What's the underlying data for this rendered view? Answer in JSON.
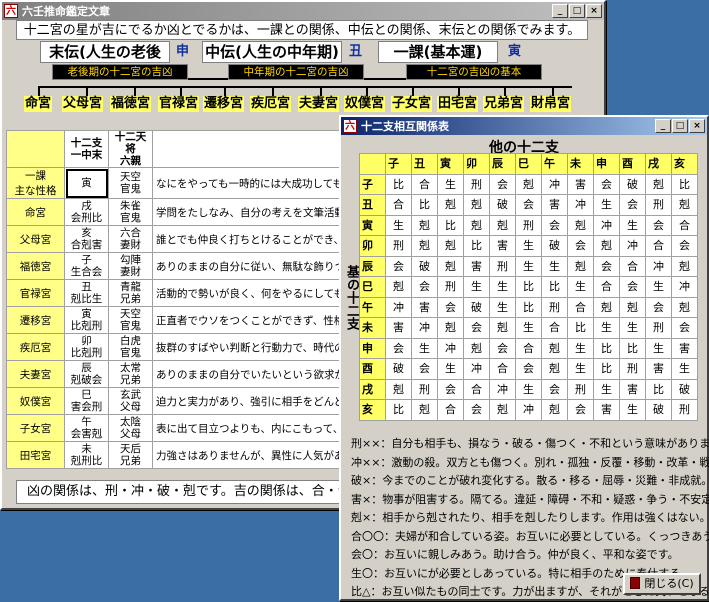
{
  "main": {
    "title": "六壬推命鑑定文章",
    "intro": "十二宮の星が吉にでるか凶とでるかは、一課との関係、中伝との関係、末伝との関係でみます。",
    "periods": [
      {
        "label": "末伝(人生の老後期)",
        "branch": "申"
      },
      {
        "label": "中伝(人生の中年期)",
        "branch": "丑"
      },
      {
        "label": "一課(基本運)",
        "branch": "寅"
      }
    ],
    "keys": [
      "老後期の十二宮の吉凶",
      "中年期の十二宮の吉凶",
      "十二宮の吉凶の基本"
    ],
    "palaces": [
      "命宮",
      "父母宮",
      "福徳宮",
      "官禄宮",
      "遷移宮",
      "疾厄宮",
      "夫妻宮",
      "奴僕宮",
      "子女宮",
      "田宅宮",
      "兄弟宮",
      "財帛宮"
    ],
    "table": {
      "headers": [
        "十二支\n一中末",
        "十二天将\n六親",
        ""
      ],
      "rows": [
        {
          "label": "一課\n主な性格",
          "c1": "寅",
          "c2": "天空\n官鬼",
          "text": "なにをやっても一時的には大成功しても、"
        },
        {
          "label": "命宮",
          "c1": "戌\n会刑比",
          "c2": "朱雀\n官鬼",
          "text": "学問をたしなみ、自分の考えを文筆活動"
        },
        {
          "label": "父母宮",
          "c1": "亥\n合剋害",
          "c2": "六合\n妻財",
          "text": "誰とでも仲良く打ちとけることができ、人"
        },
        {
          "label": "福徳宮",
          "c1": "子\n生合会",
          "c2": "勾陣\n妻財",
          "text": "ありのままの自分に従い、無駄な飾りつけ"
        },
        {
          "label": "官禄宮",
          "c1": "丑\n剋比生",
          "c2": "青龍\n兄弟",
          "text": "活動的で勢いが良く、何をやるにしても大"
        },
        {
          "label": "遷移宮",
          "c1": "寅\n比剋刑",
          "c2": "天空\n官鬼",
          "text": "正直者でウソをつくことができず、性格的"
        },
        {
          "label": "疾厄宮",
          "c1": "卯\n比剋刑",
          "c2": "白虎\n官鬼",
          "text": "抜群のすばやい判断と行動力で、時代の波"
        },
        {
          "label": "夫妻宮",
          "c1": "辰\n剋破会",
          "c2": "太常\n兄弟",
          "text": "ありのままの自分でいたいという欲求が強"
        },
        {
          "label": "奴僕宮",
          "c1": "巳\n害会刑",
          "c2": "玄武\n父母",
          "text": "迫力と実力があり、強引に相手をどんどん"
        },
        {
          "label": "子女宮",
          "c1": "午\n会害剋",
          "c2": "太陰\n父母",
          "text": "表に出て目立つよりも、内にこもって、ま"
        },
        {
          "label": "田宅宮",
          "c1": "未\n剋刑比",
          "c2": "天后\n兄弟",
          "text": "力強さはありませんが、異性に人気があり"
        }
      ]
    },
    "footer": "凶の関係は、刑・冲・破・剋です。吉の関係は、合・会・生・同"
  },
  "relation": {
    "title": "十二支相互関係表",
    "top_label": "他の十二支",
    "side_label": "基の十二支",
    "branches": [
      "子",
      "丑",
      "寅",
      "卯",
      "辰",
      "巳",
      "午",
      "未",
      "申",
      "酉",
      "戌",
      "亥"
    ],
    "matrix": [
      [
        "比",
        "合",
        "生",
        "刑",
        "会",
        "剋",
        "冲",
        "害",
        "会",
        "破",
        "剋",
        "比"
      ],
      [
        "合",
        "比",
        "剋",
        "剋",
        "破",
        "会",
        "害",
        "冲",
        "生",
        "会",
        "刑",
        "剋"
      ],
      [
        "生",
        "剋",
        "比",
        "剋",
        "剋",
        "刑",
        "会",
        "剋",
        "冲",
        "生",
        "会",
        "合"
      ],
      [
        "刑",
        "剋",
        "剋",
        "比",
        "害",
        "生",
        "破",
        "会",
        "剋",
        "冲",
        "合",
        "会"
      ],
      [
        "会",
        "破",
        "剋",
        "害",
        "刑",
        "生",
        "生",
        "剋",
        "会",
        "合",
        "冲",
        "剋"
      ],
      [
        "剋",
        "会",
        "刑",
        "生",
        "生",
        "比",
        "比",
        "生",
        "合",
        "会",
        "生",
        "冲"
      ],
      [
        "冲",
        "害",
        "会",
        "破",
        "生",
        "比",
        "刑",
        "合",
        "剋",
        "剋",
        "会",
        "剋"
      ],
      [
        "害",
        "冲",
        "剋",
        "会",
        "剋",
        "生",
        "合",
        "比",
        "生",
        "生",
        "刑",
        "会"
      ],
      [
        "会",
        "生",
        "冲",
        "剋",
        "会",
        "合",
        "剋",
        "生",
        "比",
        "比",
        "生",
        "害"
      ],
      [
        "破",
        "会",
        "生",
        "冲",
        "合",
        "会",
        "剋",
        "生",
        "比",
        "刑",
        "害",
        "生"
      ],
      [
        "剋",
        "刑",
        "会",
        "合",
        "冲",
        "生",
        "会",
        "刑",
        "生",
        "害",
        "比",
        "破"
      ],
      [
        "比",
        "剋",
        "合",
        "会",
        "剋",
        "冲",
        "剋",
        "会",
        "害",
        "生",
        "破",
        "刑"
      ]
    ],
    "legend": [
      "刑××：自分も相手も、損なう・破る・傷つく・不和という意味があります。",
      "冲××：激動の殺。双方とも傷つく。別れ・孤独・反覆・移動・改革・戦い。",
      "破×：今までのことが破れ変化する。散る・移る・屈辱・災難・非成就。",
      "害×：物事が阻害する。隔てる。違延・障碍・不和・疑惑・争う・不安定。",
      "剋×：相手から剋されたり、相手を剋したりします。作用は強くはない。",
      "合〇〇：夫婦が和合している姿。お互いに必要としている。くっつきあう。",
      "会〇：お互いに親しみあう。助け合う。仲が良く、平和な姿です。",
      "生〇：お互いにが必要としあっている。特に相手のために奉仕する。",
      "比△：お互い似たもの同士です。力が出ますが、それがときに災いとなる。"
    ],
    "close_label": "閉じる(C)"
  }
}
